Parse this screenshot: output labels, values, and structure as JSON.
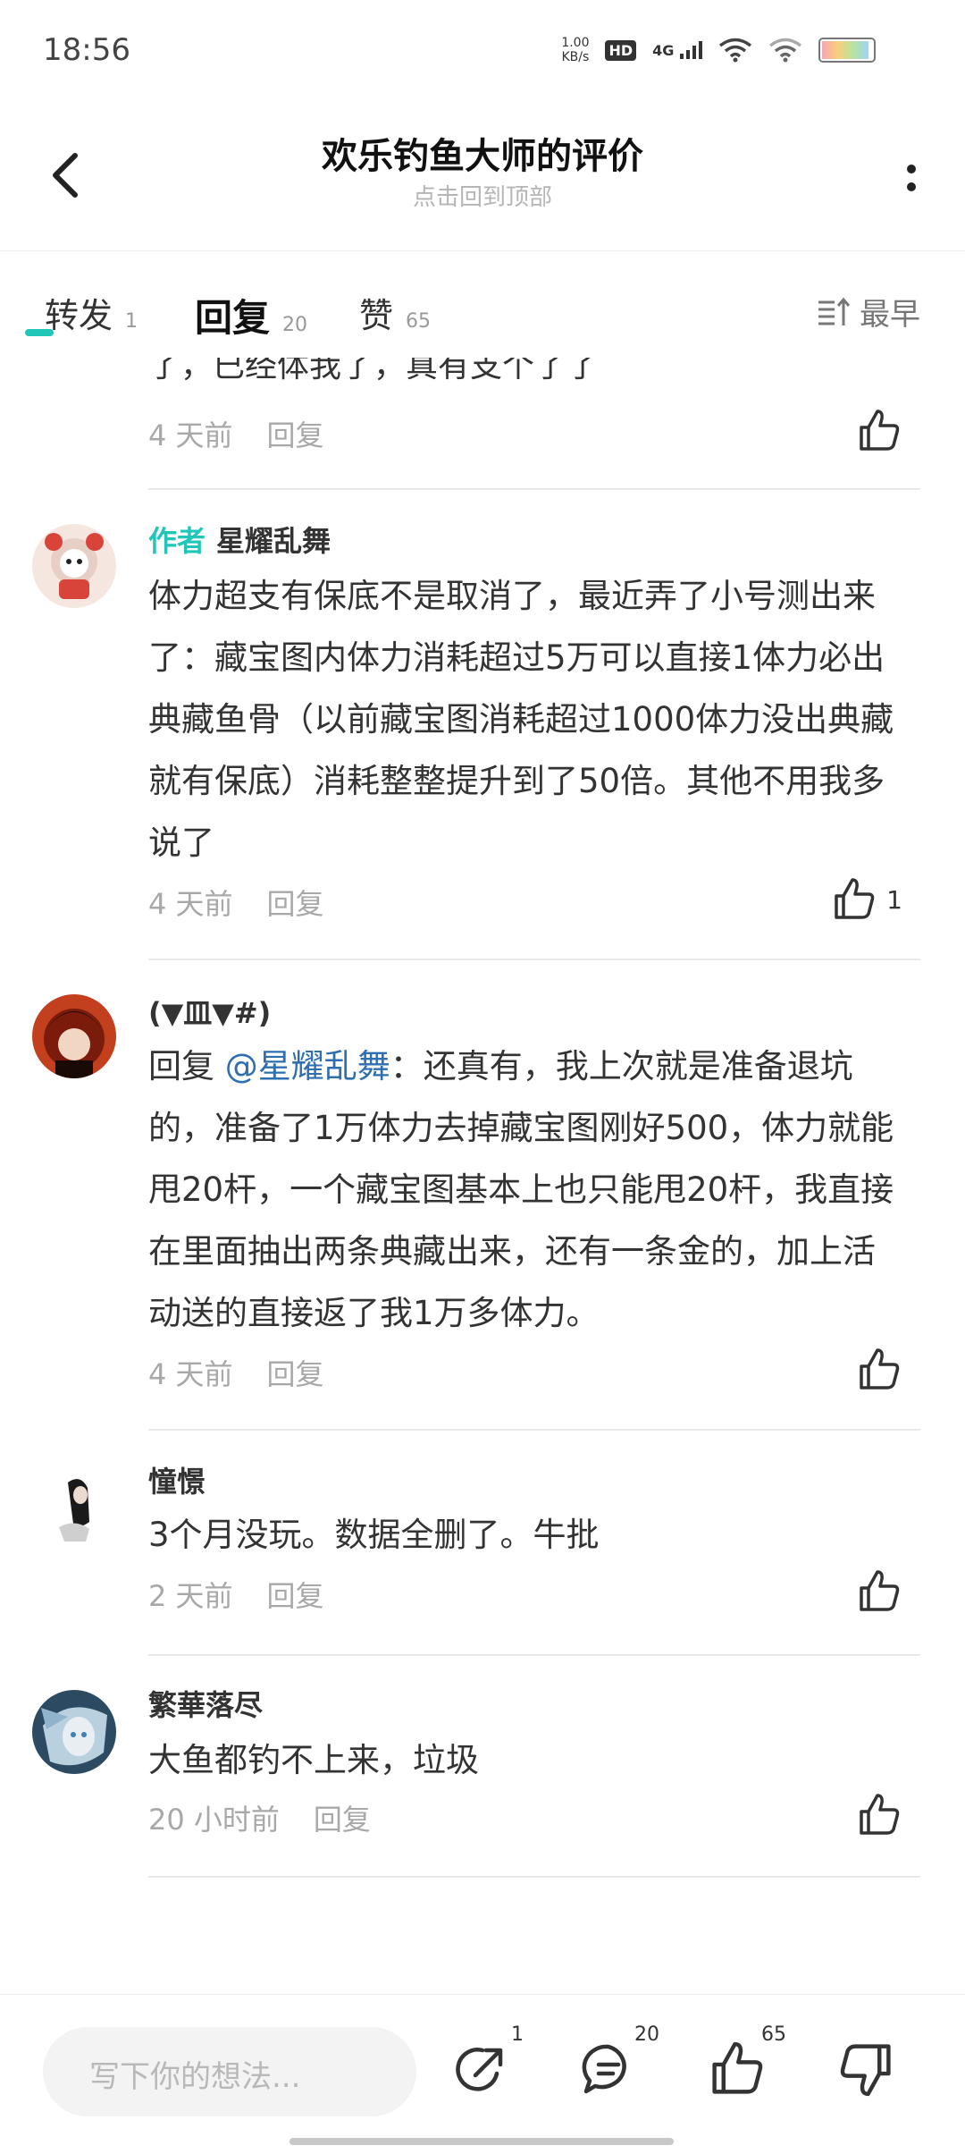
{
  "status_bar": {
    "time": "18:56",
    "net_speed_value": "1.00",
    "net_speed_unit": "KB/s",
    "hd": "HD",
    "network": "4G",
    "icons": [
      "hd-icon",
      "signal-icon",
      "wifi-icon",
      "wifi-icon",
      "battery-icon"
    ]
  },
  "header": {
    "title": "欢乐钓鱼大师的评价",
    "subtitle": "点击回到顶部"
  },
  "tabs": [
    {
      "label": "转发",
      "count": "1"
    },
    {
      "label": "回复",
      "count": "20"
    },
    {
      "label": "赞",
      "count": "65"
    }
  ],
  "sort": {
    "label": "最早"
  },
  "partial_comment": {
    "text": "了，已经体我了，真有支个了了",
    "time": "4 天前",
    "reply": "回复"
  },
  "comments": [
    {
      "author_tag": "作者",
      "name": "星耀乱舞",
      "text": "体力超支有保底不是取消了，最近弄了小号测出来了：藏宝图内体力消耗超过5万可以直接1体力必出典藏鱼骨（以前藏宝图消耗超过1000体力没出典藏就有保底）消耗整整提升到了50倍。其他不用我多说了",
      "time": "4 天前",
      "reply": "回复",
      "likes": "1"
    },
    {
      "name": "(▼皿▼#)",
      "reply_prefix": "回复 ",
      "mention": "@星耀乱舞",
      "text": "：还真有，我上次就是准备退坑的，准备了1万体力去掉藏宝图刚好500，体力就能甩20杆，一个藏宝图基本上也只能甩20杆，我直接在里面抽出两条典藏出来，还有一条金的，加上活动送的直接返了我1万多体力。",
      "time": "4 天前",
      "reply": "回复"
    },
    {
      "name": "憧憬",
      "text": "3个月没玩。数据全删了。牛批",
      "time": "2 天前",
      "reply": "回复"
    },
    {
      "name": "繁華落尽",
      "text": "大鱼都钓不上来，垃圾",
      "time": "20 小时前",
      "reply": "回复"
    }
  ],
  "bottom_bar": {
    "placeholder": "写下你的想法...",
    "share_count": "1",
    "comment_count": "20",
    "like_count": "65"
  },
  "colors": {
    "accent": "#21c6b8",
    "mention": "#2f6fb0",
    "muted": "#a8a8a8"
  }
}
